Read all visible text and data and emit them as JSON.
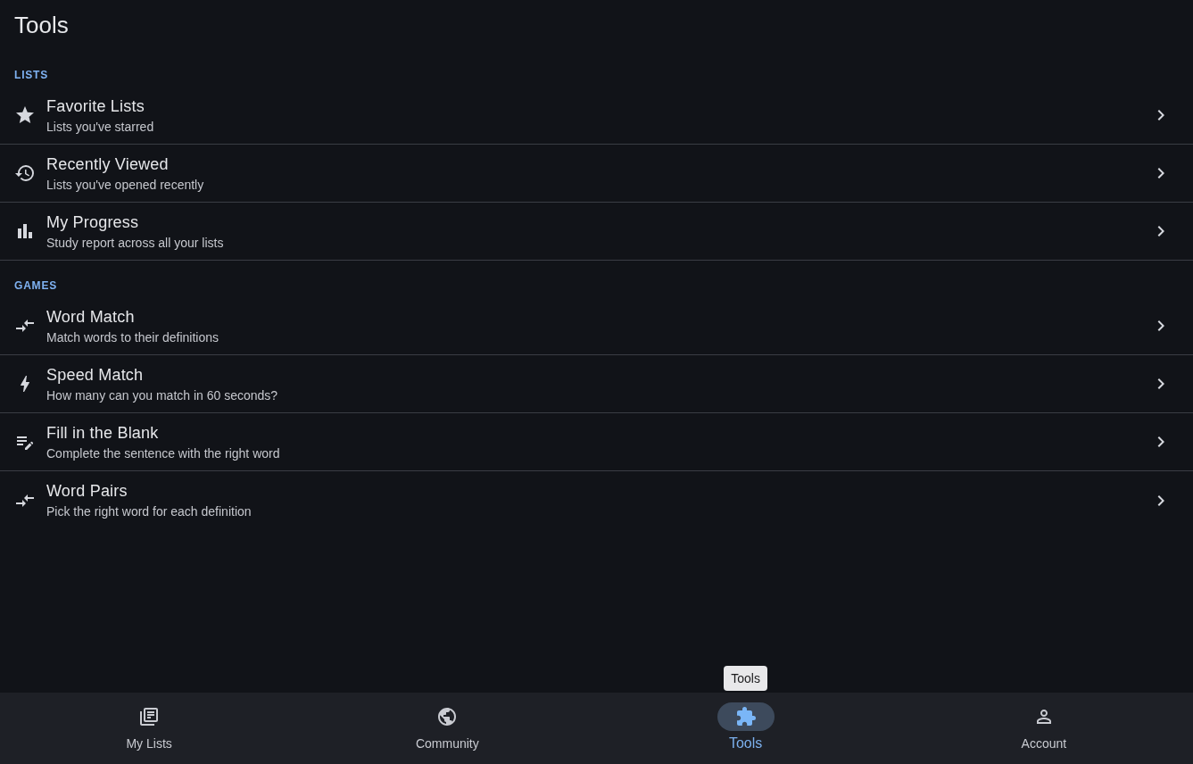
{
  "header": {
    "title": "Tools"
  },
  "sections": [
    {
      "label": "LISTS",
      "items": [
        {
          "title": "Favorite Lists",
          "subtitle": "Lists you've starred"
        },
        {
          "title": "Recently Viewed",
          "subtitle": "Lists you've opened recently"
        },
        {
          "title": "My Progress",
          "subtitle": "Study report across all your lists"
        }
      ]
    },
    {
      "label": "GAMES",
      "items": [
        {
          "title": "Word Match",
          "subtitle": "Match words to their definitions"
        },
        {
          "title": "Speed Match",
          "subtitle": "How many can you match in 60 seconds?"
        },
        {
          "title": "Fill in the Blank",
          "subtitle": "Complete the sentence with the right word"
        },
        {
          "title": "Word Pairs",
          "subtitle": "Pick the right word for each definition"
        }
      ]
    }
  ],
  "bottom_nav": {
    "tooltip": "Tools",
    "items": [
      {
        "label": "My Lists",
        "selected": false
      },
      {
        "label": "Community",
        "selected": false
      },
      {
        "label": "Tools",
        "selected": true
      },
      {
        "label": "Account",
        "selected": false
      }
    ]
  }
}
